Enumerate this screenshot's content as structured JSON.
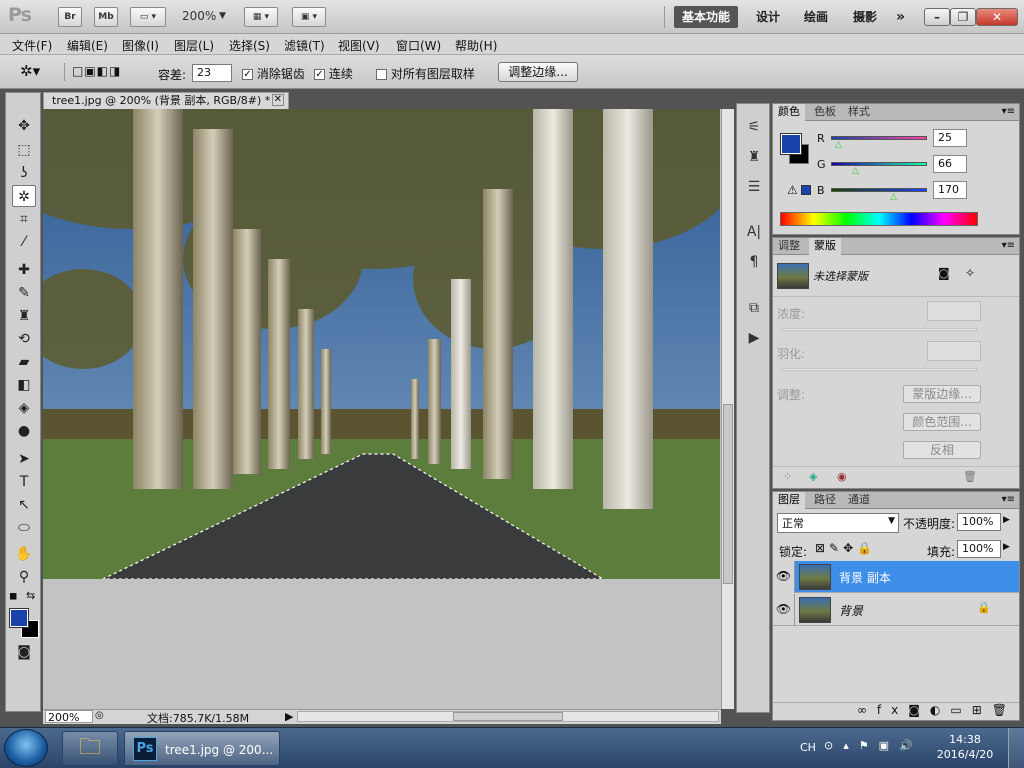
{
  "app": {
    "logo": "Ps",
    "bridge": "Br",
    "minibridge": "Mb",
    "zoom": "200%"
  },
  "workspaces": [
    "基本功能",
    "设计",
    "绘画",
    "摄影"
  ],
  "menu": [
    "文件(F)",
    "编辑(E)",
    "图像(I)",
    "图层(L)",
    "选择(S)",
    "滤镜(T)",
    "视图(V)",
    "窗口(W)",
    "帮助(H)"
  ],
  "options": {
    "tolerance_label": "容差:",
    "tolerance_value": "23",
    "antialias_label": "消除锯齿",
    "contiguous_label": "连续",
    "sample_all_label": "对所有图层取样",
    "refine_edge_label": "调整边缘..."
  },
  "document": {
    "tab_title": "tree1.jpg @ 200% (背景 副本, RGB/8#) *",
    "zoom": "200%",
    "status": "文档:785.7K/1.58M"
  },
  "color_panel": {
    "tabs": [
      "颜色",
      "色板",
      "样式"
    ],
    "r_label": "R",
    "g_label": "G",
    "b_label": "B",
    "r_value": "25",
    "g_value": "66",
    "b_value": "170",
    "fg_color": "#1942aa"
  },
  "masks_panel": {
    "tabs": [
      "调整",
      "蒙版"
    ],
    "no_mask": "未选择蒙版",
    "density_label": "浓度:",
    "feather_label": "羽化:",
    "adjust_label": "调整:",
    "mask_edge": "蒙版边缘...",
    "color_range": "颜色范围...",
    "invert": "反相"
  },
  "layers_panel": {
    "tabs": [
      "图层",
      "路径",
      "通道"
    ],
    "blend_mode": "正常",
    "opacity_label": "不透明度:",
    "opacity_value": "100%",
    "lock_label": "锁定:",
    "fill_label": "填充:",
    "fill_value": "100%",
    "layers": [
      {
        "name": "背景 副本",
        "selected": true
      },
      {
        "name": "背景",
        "selected": false
      }
    ]
  },
  "taskbar": {
    "task_title": "tree1.jpg @ 200...",
    "lang": "CH",
    "time": "14:38",
    "date": "2016/4/20"
  }
}
